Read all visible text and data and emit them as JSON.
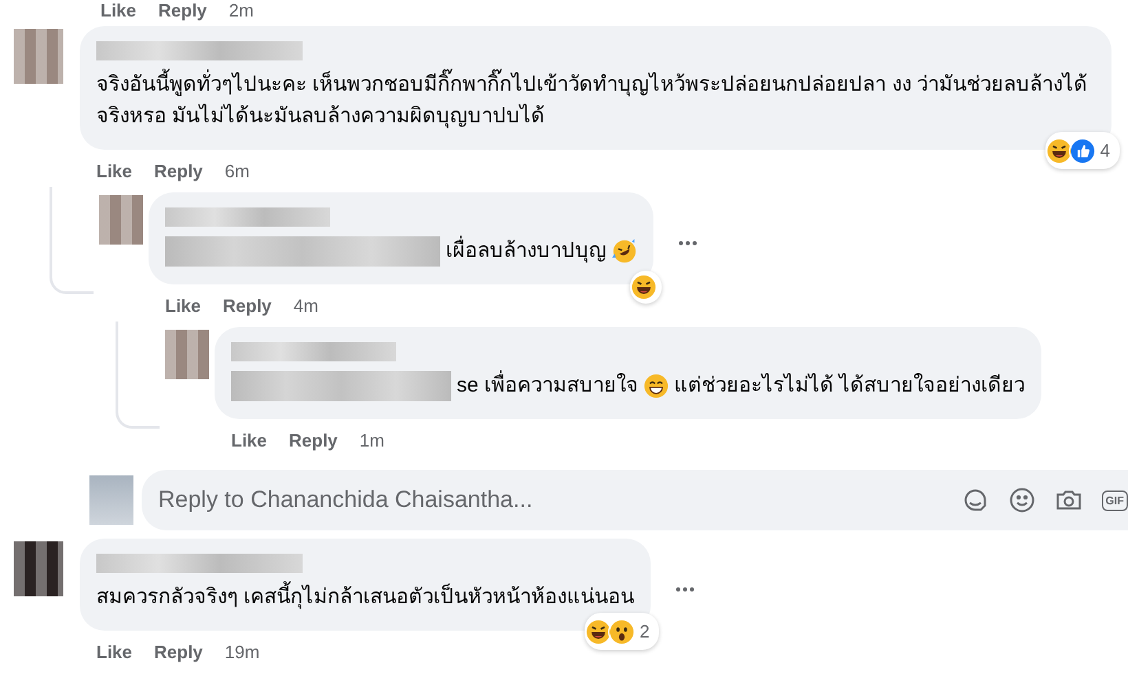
{
  "previous_actions": {
    "like": "Like",
    "reply": "Reply",
    "time": "2m"
  },
  "comments": [
    {
      "segments": [
        {
          "kind": "text",
          "text": "จริงอันนี้พูดทั่วๆไปนะคะ เห็นพวกชอบมีกิ๊กพากิ๊กไปเข้าวัดทำบุญไหว้พระปล่อยนกปล่อยปลา งง ว่ามันช่วยลบล้างได้จริงหรอ มันไม่ได้นะมันลบล้างความผิดบุญบาปบได้"
        }
      ],
      "reactions": {
        "icons": [
          {
            "kind": "laughing"
          },
          {
            "kind": "like"
          }
        ],
        "count": "4"
      },
      "more": false,
      "actions": {
        "like": "Like",
        "reply": "Reply",
        "time": "6m"
      },
      "children": [
        {
          "segments": [
            {
              "kind": "blur"
            },
            {
              "kind": "text",
              "text": "เผื่อลบล้างบาปบุญ"
            },
            {
              "kind": "laughing_tears"
            }
          ],
          "reactions": {
            "icons": [
              {
                "kind": "laughing"
              }
            ]
          },
          "more": true,
          "actions": {
            "like": "Like",
            "reply": "Reply",
            "time": "4m"
          },
          "children": [
            {
              "segments": [
                {
                  "kind": "blur"
                },
                {
                  "kind": "text",
                  "text": "se เพื่อความสบายใจ"
                },
                {
                  "kind": "grinning"
                },
                {
                  "kind": "text",
                  "text": "แต่ช่วยอะไรไม่ได้ ได้สบายใจอย่างเดียว"
                }
              ],
              "more": false,
              "actions": {
                "like": "Like",
                "reply": "Reply",
                "time": "1m"
              }
            }
          ]
        }
      ],
      "reply_box": {
        "placeholder": "Reply to Chananchida Chaisantha...",
        "icons": [
          {
            "kind": "sticker"
          },
          {
            "kind": "smiley"
          },
          {
            "kind": "camera"
          },
          {
            "kind": "gif",
            "label": "GIF"
          }
        ]
      }
    },
    {
      "segments": [
        {
          "kind": "text",
          "text": "สมควรกลัวจริงๆ เคสนี้กุไม่กล้าเสนอตัวเป็นหัวหน้าห้องแน่นอน"
        }
      ],
      "reactions": {
        "icons": [
          {
            "kind": "laughing"
          },
          {
            "kind": "wow"
          }
        ],
        "count": "2"
      },
      "more": true,
      "actions": {
        "like": "Like",
        "reply": "Reply",
        "time": "19m"
      }
    }
  ]
}
